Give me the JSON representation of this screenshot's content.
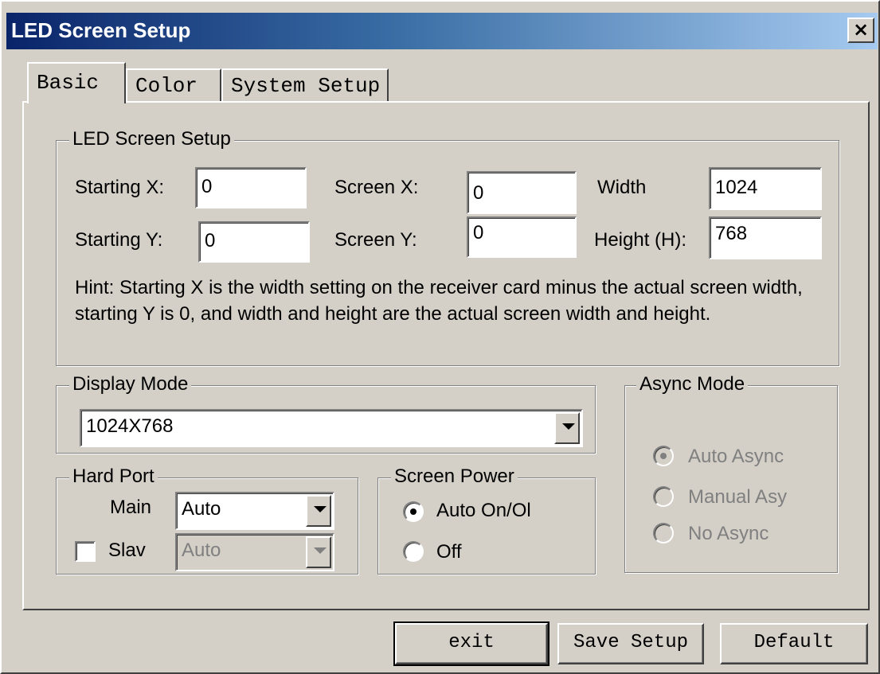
{
  "window": {
    "title": "LED Screen Setup",
    "close_glyph": "×"
  },
  "tabs": [
    {
      "label": "Basic",
      "active": true
    },
    {
      "label": "Color",
      "active": false
    },
    {
      "label": "System Setup",
      "active": false
    }
  ],
  "led_setup": {
    "group_label": "LED Screen Setup",
    "starting_x_label": "Starting X:",
    "starting_x_value": "0",
    "starting_y_label": "Starting Y:",
    "starting_y_value": "0",
    "screen_x_label": "Screen X:",
    "screen_x_value": "0",
    "screen_y_label": "Screen Y:",
    "screen_y_value": "0",
    "width_label": "Width",
    "width_value": "1024",
    "height_label": "Height (H):",
    "height_value": "768",
    "hint": "Hint: Starting X is the width setting on the receiver card minus the actual screen width, starting Y is 0, and width and height are the actual screen width and height."
  },
  "display_mode": {
    "group_label": "Display Mode",
    "value": "1024X768"
  },
  "hard_port": {
    "group_label": "Hard Port",
    "main_label": "Main",
    "main_value": "Auto",
    "slave_label": "Slav",
    "slave_value": "Auto",
    "slave_checked": false
  },
  "screen_power": {
    "group_label": "Screen Power",
    "options": [
      {
        "label": "Auto On/Ol",
        "checked": true
      },
      {
        "label": "Off",
        "checked": false
      }
    ]
  },
  "async_mode": {
    "group_label": "Async Mode",
    "options": [
      {
        "label": "Auto Async",
        "checked": true
      },
      {
        "label": "Manual Asy",
        "checked": false
      },
      {
        "label": "No Async",
        "checked": false
      }
    ]
  },
  "buttons": {
    "exit": "exit",
    "save": "Save Setup",
    "default": "Default"
  }
}
